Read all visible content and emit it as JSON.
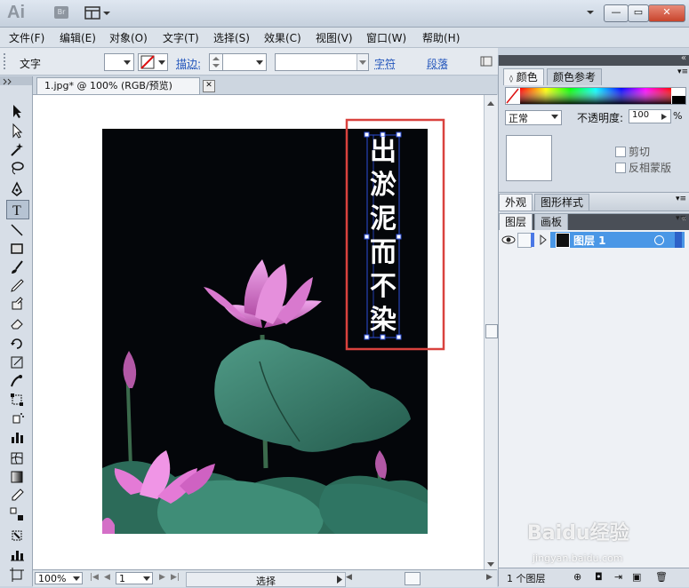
{
  "app": {
    "logo": "Ai",
    "bridge": "Br"
  },
  "window": {
    "minimize": "—",
    "restore": "▭",
    "close": "✕"
  },
  "menu": [
    "文件(F)",
    "编辑(E)",
    "对象(O)",
    "文字(T)",
    "选择(S)",
    "效果(C)",
    "视图(V)",
    "窗口(W)",
    "帮助(H)"
  ],
  "control": {
    "tool_label": "文字",
    "stroke_label": "描边:",
    "char_link": "字符",
    "para_link": "段落"
  },
  "document": {
    "tab_title": "1.jpg* @ 100% (RGB/预览)",
    "vertical_text": [
      "出",
      "淤",
      "泥",
      "而",
      "不",
      "染"
    ]
  },
  "status": {
    "zoom": "100%",
    "page": "1",
    "mode": "选择"
  },
  "color_panel": {
    "tabs": [
      "颜色",
      "颜色参考"
    ]
  },
  "transparency_panel": {
    "blend_mode": "正常",
    "opacity_label": "不透明度:",
    "opacity_value": "100",
    "opacity_unit": "%",
    "clip_label": "剪切",
    "invert_mask_label": "反相蒙版"
  },
  "appearance_panel": {
    "tabs": [
      "外观",
      "图形样式"
    ]
  },
  "layers_panel": {
    "tabs": [
      "图层",
      "画板"
    ],
    "layers": [
      {
        "name": "图层 1"
      }
    ],
    "footer_count": "1 个图层"
  },
  "watermark": {
    "brand": "Baidu经验",
    "url": "jingyan.baidu.com"
  },
  "colors": {
    "accent": "#3d8be3",
    "selection_frame": "#d9423e",
    "lotus_pink": "#e98ee0",
    "leaf_green": "#3c7a68",
    "layer_highlight": "#4a97e6"
  }
}
